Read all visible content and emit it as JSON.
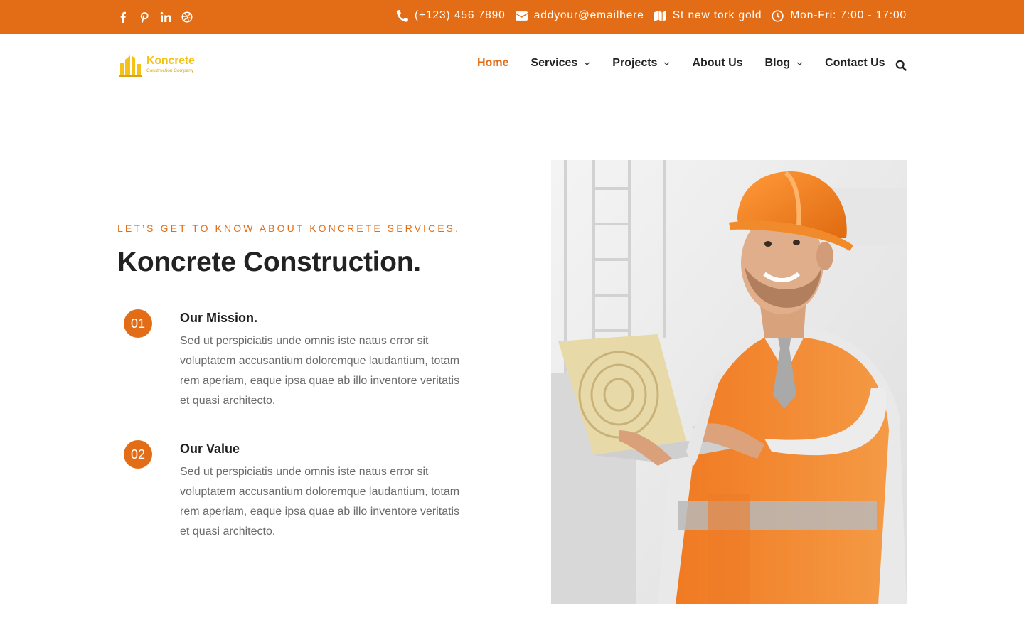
{
  "topbar": {
    "social": [
      {
        "name": "facebook-icon"
      },
      {
        "name": "pinterest-icon"
      },
      {
        "name": "linkedin-icon"
      },
      {
        "name": "dribbble-icon"
      }
    ],
    "phone": "(+123) 456 7890",
    "email": "addyour@emailhere",
    "address": "St new tork gold",
    "hours": "Mon-Fri: 7:00 - 17:00"
  },
  "header": {
    "logo_name": "Koncrete",
    "logo_tagline": "Construction Company",
    "nav": [
      {
        "label": "Home",
        "active": true,
        "dropdown": false
      },
      {
        "label": "Services",
        "active": false,
        "dropdown": true
      },
      {
        "label": "Projects",
        "active": false,
        "dropdown": true
      },
      {
        "label": "About Us",
        "active": false,
        "dropdown": false
      },
      {
        "label": "Blog",
        "active": false,
        "dropdown": true
      },
      {
        "label": "Contact Us",
        "active": false,
        "dropdown": false
      }
    ]
  },
  "about": {
    "eyebrow": "LET’S GET TO KNOW ABOUT KONCRETE SERVICES.",
    "title": "Koncrete Construction.",
    "features": [
      {
        "number": "01",
        "title": "Our Mission.",
        "text": "Sed ut perspiciatis unde omnis iste natus error sit voluptatem accusantium doloremque laudantium, totam rem aperiam, eaque ipsa quae ab illo inventore veritatis et quasi architecto."
      },
      {
        "number": "02",
        "title": "Our Value",
        "text": "Sed ut perspiciatis unde omnis iste natus error sit voluptatem accusantium doloremque laudantium, totam rem aperiam, eaque ipsa quae ab illo inventore veritatis et quasi architecto."
      }
    ]
  },
  "colors": {
    "accent": "#e36d16",
    "logo": "#f5c21a",
    "heading": "#222222",
    "body_text": "#6b6b6b"
  }
}
